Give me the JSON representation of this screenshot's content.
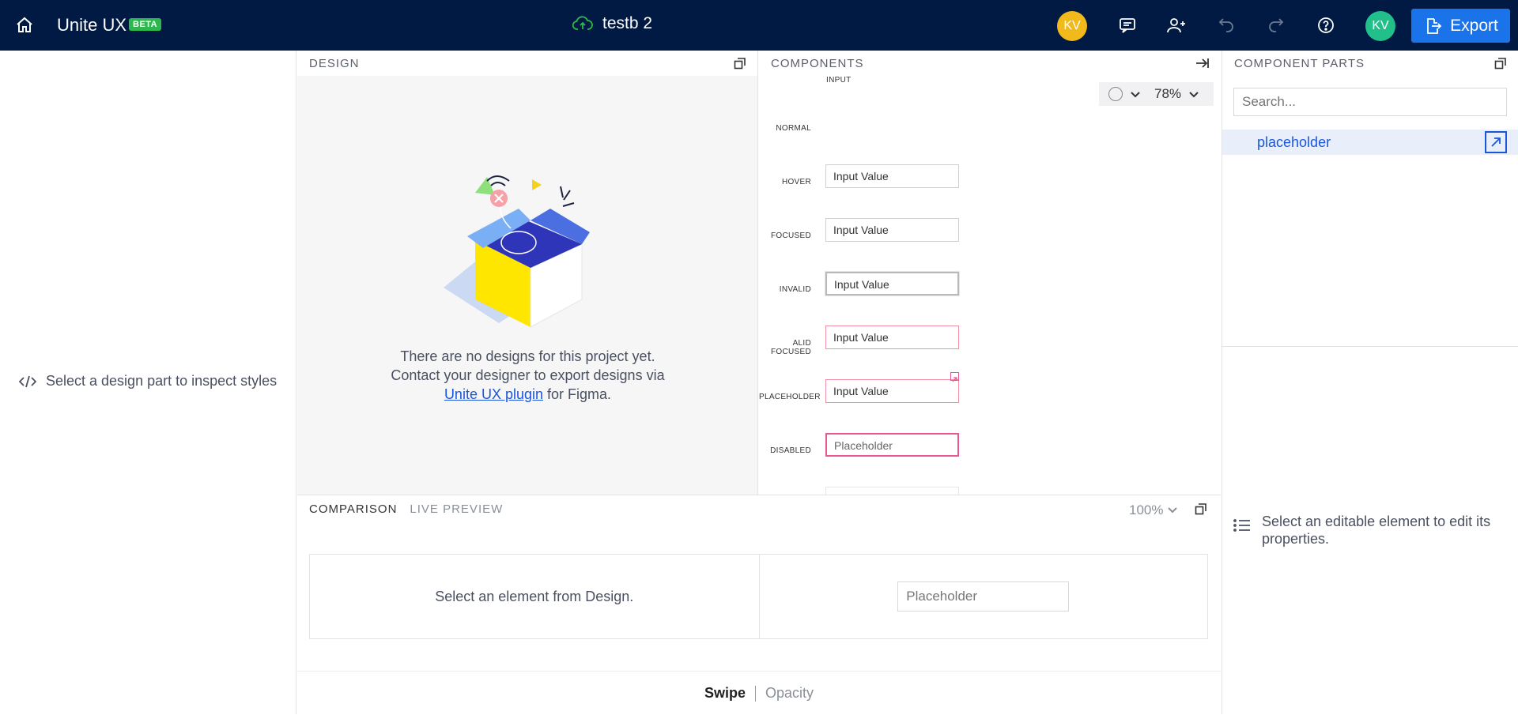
{
  "header": {
    "app_title": "Unite UX",
    "beta_badge": "BETA",
    "project_name": "testb 2",
    "user_initials_1": "KV",
    "user_initials_2": "KV",
    "export_label": "Export"
  },
  "left_panel": {
    "message": "Select a design part to inspect styles"
  },
  "design": {
    "title": "DESIGN",
    "empty_line_1": "There are no designs for this project yet.",
    "empty_line_2": "Contact your designer to export designs via",
    "plugin_link": "Unite UX plugin",
    "empty_suffix": "for Figma."
  },
  "components": {
    "title": "COMPONENTS",
    "section_label": "INPUT",
    "zoom": "78%",
    "rows": [
      {
        "label": "NORMAL",
        "value": "Input Value",
        "state": "normal"
      },
      {
        "label": "HOVER",
        "value": "Input Value",
        "state": "hover"
      },
      {
        "label": "FOCUSED",
        "value": "Input Value",
        "state": "focused"
      },
      {
        "label": "INVALID",
        "value": "Input Value",
        "state": "invalid"
      },
      {
        "label": "ALID FOCUSED",
        "value": "Input Value",
        "state": "invalid"
      },
      {
        "label": "PLACEHOLDER",
        "value": "Placeholder",
        "state": "placeholder"
      },
      {
        "label": "DISABLED",
        "value": "Input Value",
        "state": "disabled"
      }
    ]
  },
  "parts": {
    "title": "COMPONENT PARTS",
    "search_placeholder": "Search...",
    "selected_item": "placeholder",
    "hint": "Select an editable element to edit its properties."
  },
  "comparison": {
    "tab_comparison": "COMPARISON",
    "tab_live": "LIVE PREVIEW",
    "zoom": "100%",
    "left_message": "Select an element from Design.",
    "right_placeholder": "Placeholder",
    "mode_swipe": "Swipe",
    "mode_opacity": "Opacity"
  },
  "colors": {
    "topbar": "#001a44",
    "accent": "#1a73e8",
    "beta": "#2db84d",
    "invalid_border": "#f28da3",
    "selection": "#e8578f"
  }
}
